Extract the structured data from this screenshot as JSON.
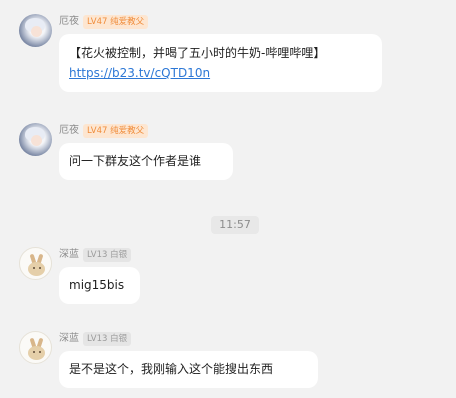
{
  "messages": [
    {
      "name": "厄夜",
      "badge": "LV47 纯爱教父",
      "text": "【花火被控制，并喝了五小时的牛奶-哔哩哔哩】",
      "link": "https://b23.tv/cQTD10n"
    },
    {
      "name": "厄夜",
      "badge": "LV47 纯爱教父",
      "text": "问一下群友这个作者是谁"
    },
    {
      "name": "深蓝",
      "badge": "LV13 白银",
      "text": "mig15bis"
    },
    {
      "name": "深蓝",
      "badge": "LV13 白银",
      "text": "是不是这个，我刚输入这个能搜出东西"
    }
  ],
  "timestamp": "11:57",
  "colors": {
    "background": "#f2f2f2",
    "bubble": "#ffffff",
    "link": "#2d78d6",
    "badge_orange_bg": "#fde6d1",
    "badge_orange_text": "#f08c3a",
    "badge_gray_bg": "#e5e5e5",
    "badge_gray_text": "#9b9b9b"
  }
}
